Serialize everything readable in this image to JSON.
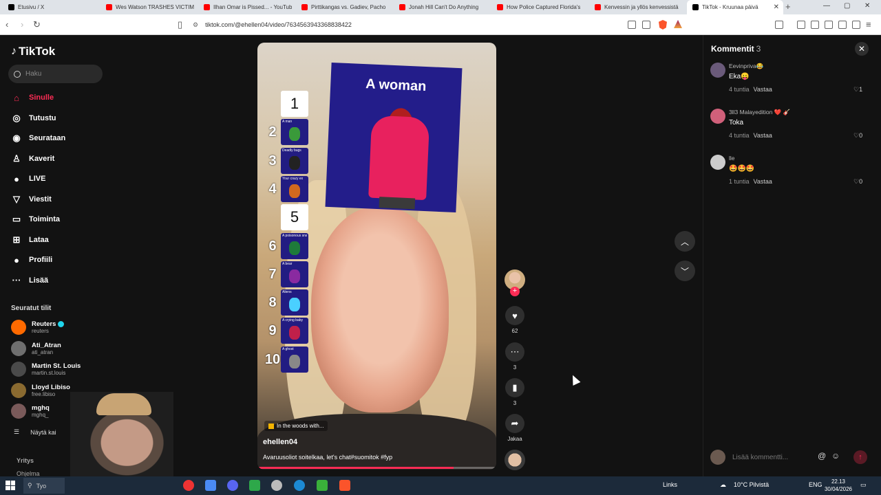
{
  "browser": {
    "tabs": [
      {
        "title": "Etusivu / X",
        "color": "#000000"
      },
      {
        "title": "Wes Watson TRASHES VICTIM",
        "color": "#ff0000"
      },
      {
        "title": "Ilhan Omar is Pissed... - YouTub",
        "color": "#ff0000"
      },
      {
        "title": "Pirttikangas vs. Gadiev, Pacho",
        "color": "#ff0000"
      },
      {
        "title": "Jonah Hill Can't Do Anything",
        "color": "#ff0000"
      },
      {
        "title": "How Police Captured Florida's",
        "color": "#ff0000"
      },
      {
        "title": "Kenvessin ja yllös kenvessistä",
        "color": "#ff0000"
      },
      {
        "title": "TikTok - Kruunaa päivä",
        "color": "#000000"
      }
    ],
    "url": "tiktok.com/@ehellen04/video/7634563943368838422"
  },
  "sidebar": {
    "logo": "TikTok",
    "search_placeholder": "Haku",
    "nav": [
      {
        "label": "Sinulle",
        "icon": "home-icon",
        "glyph": "⌂"
      },
      {
        "label": "Tutustu",
        "icon": "compass-icon",
        "glyph": "◎"
      },
      {
        "label": "Seurataan",
        "icon": "following-icon",
        "glyph": "◉"
      },
      {
        "label": "Kaverit",
        "icon": "friends-icon",
        "glyph": "♙"
      },
      {
        "label": "LIVE",
        "icon": "live-icon",
        "glyph": "●"
      },
      {
        "label": "Viestit",
        "icon": "messages-icon",
        "glyph": "▽"
      },
      {
        "label": "Toiminta",
        "icon": "activity-icon",
        "glyph": "▭"
      },
      {
        "label": "Lataa",
        "icon": "upload-icon",
        "glyph": "⊞"
      },
      {
        "label": "Profiili",
        "icon": "profile-icon",
        "glyph": "●"
      },
      {
        "label": "Lisää",
        "icon": "more-icon",
        "glyph": "···"
      }
    ],
    "followed_title": "Seuratut tilit",
    "followed": [
      {
        "name": "Reuters",
        "handle": "reuters",
        "color": "#ff6a00"
      },
      {
        "name": "Ati_Atran",
        "handle": "ati_atran",
        "color": "#6f6f6f"
      },
      {
        "name": "Martin St. Louis",
        "handle": "martin.st.louis",
        "color": "#4a4a4a"
      },
      {
        "name": "Lloyd Libiso",
        "handle": "free.libiso",
        "color": "#8a6a30"
      },
      {
        "name": "mghq",
        "handle": "mghq_",
        "color": "#7a5a5a"
      }
    ],
    "see_all": "Näytä kai",
    "company": "Yritys",
    "programs": "Ohjelma"
  },
  "video": {
    "card_caption": "A woman",
    "ranks": [
      {
        "num": "1",
        "label": "",
        "color": "#ffffff"
      },
      {
        "num": "2",
        "label": "A man",
        "color": "#3a9a3a"
      },
      {
        "num": "3",
        "label": "Deadly bugs",
        "color": "#222222"
      },
      {
        "num": "4",
        "label": "Your crazy ex",
        "color": "#d2691e"
      },
      {
        "num": "5",
        "label": "",
        "color": "#ffffff"
      },
      {
        "num": "6",
        "label": "A poisonous snake",
        "color": "#1e7a3a"
      },
      {
        "num": "7",
        "label": "A bear",
        "color": "#8a2aa0"
      },
      {
        "num": "8",
        "label": "Aliens",
        "color": "#4ad0ff"
      },
      {
        "num": "9",
        "label": "A crying baby",
        "color": "#c0204a"
      },
      {
        "num": "10",
        "label": "A ghost",
        "color": "#888888"
      }
    ],
    "music": "In the woods with...",
    "author": "ehellen04",
    "description": "Avaruusoliot soitelkaa, let's chat#suomitok #fyp",
    "progress": 0.82
  },
  "actions": {
    "likes": "62",
    "comments": "3",
    "saves": "3",
    "share_label": "Jakaa"
  },
  "comments": {
    "title": "Kommentit",
    "count": "3",
    "items": [
      {
        "user": "Eevinpriva😂",
        "text": "Eka😛",
        "time": "4 tuntia",
        "reply": "Vastaa",
        "likes": "♡1",
        "color": "#6a5a7a"
      },
      {
        "user": "3ll3 Malayedition ❤️ 🎸",
        "text": "Toka",
        "time": "4 tuntia",
        "reply": "Vastaa",
        "likes": "♡0",
        "color": "#d0607a"
      },
      {
        "user": "lle",
        "text": "🤩🤩🤩",
        "time": "1 tuntia",
        "reply": "Vastaa",
        "likes": "♡0",
        "color": "#cccccc"
      }
    ],
    "input_placeholder": "Lisää kommentti..."
  },
  "taskbar": {
    "search": "Tyo",
    "links": "Links",
    "weather": "10°C Pilvistä",
    "lang": "ENG",
    "time": "22.13",
    "date": "30/04/2026"
  }
}
